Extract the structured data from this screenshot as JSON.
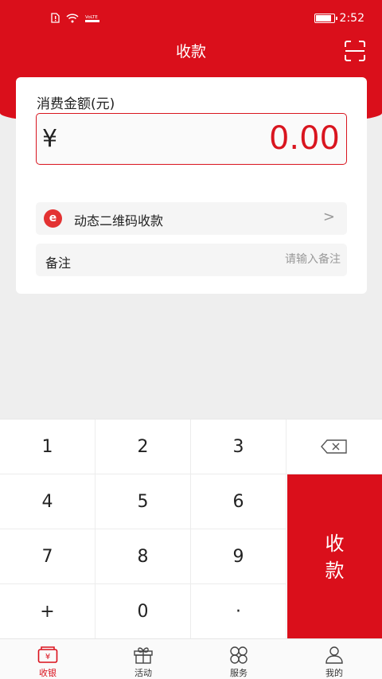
{
  "status_bar": {
    "time": "2:52",
    "carrier_tag": "VoLTE",
    "battery_level": 0.9
  },
  "header": {
    "title": "收款"
  },
  "amount": {
    "label": "消费金额(元)",
    "currency": "¥",
    "value": "0.00"
  },
  "qr_row": {
    "logo_char": "e",
    "label": "动态二维码收款",
    "chevron": ">"
  },
  "note_row": {
    "label": "备注",
    "placeholder": "请输入备注"
  },
  "keypad": {
    "keys": [
      "1",
      "2",
      "3",
      "4",
      "5",
      "6",
      "7",
      "8",
      "9",
      "+",
      "0",
      "·"
    ],
    "pay_label_top": "收",
    "pay_label_bottom": "款"
  },
  "tabs": [
    {
      "label": "收银",
      "icon": "cashier-icon",
      "active": true
    },
    {
      "label": "活动",
      "icon": "gift-icon",
      "active": false
    },
    {
      "label": "服务",
      "icon": "grid-icon",
      "active": false
    },
    {
      "label": "我的",
      "icon": "user-icon",
      "active": false
    }
  ],
  "colors": {
    "brand_red": "#da0f1b",
    "background": "#eeeeee"
  }
}
